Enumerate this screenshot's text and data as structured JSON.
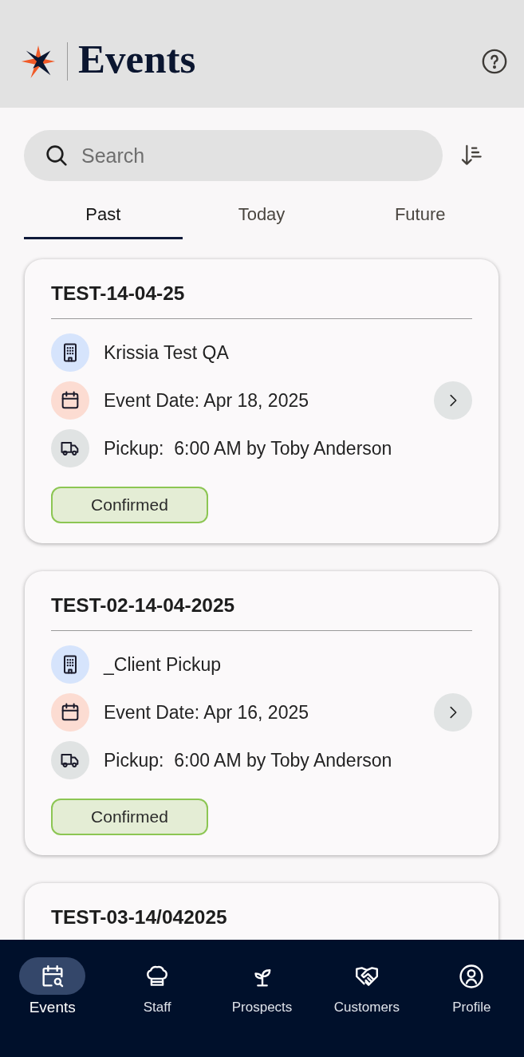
{
  "header": {
    "title": "Events"
  },
  "search": {
    "placeholder": "Search"
  },
  "tabs": [
    {
      "label": "Past",
      "selected": true
    },
    {
      "label": "Today",
      "selected": false
    },
    {
      "label": "Future",
      "selected": false
    }
  ],
  "events": [
    {
      "title": "TEST-14-04-25",
      "client": "Krissia Test QA",
      "event_date": "Event Date: Apr 18, 2025",
      "pickup": "Pickup:  6:00 AM by Toby Anderson",
      "status": "Confirmed"
    },
    {
      "title": "TEST-02-14-04-2025",
      "client": "_Client Pickup",
      "event_date": "Event Date: Apr 16, 2025",
      "pickup": "Pickup:  6:00 AM by Toby Anderson",
      "status": "Confirmed"
    },
    {
      "title": "TEST-03-14/042025"
    }
  ],
  "nav": [
    {
      "label": "Events",
      "selected": true
    },
    {
      "label": "Staff",
      "selected": false
    },
    {
      "label": "Prospects",
      "selected": false
    },
    {
      "label": "Customers",
      "selected": false
    },
    {
      "label": "Profile",
      "selected": false
    }
  ]
}
